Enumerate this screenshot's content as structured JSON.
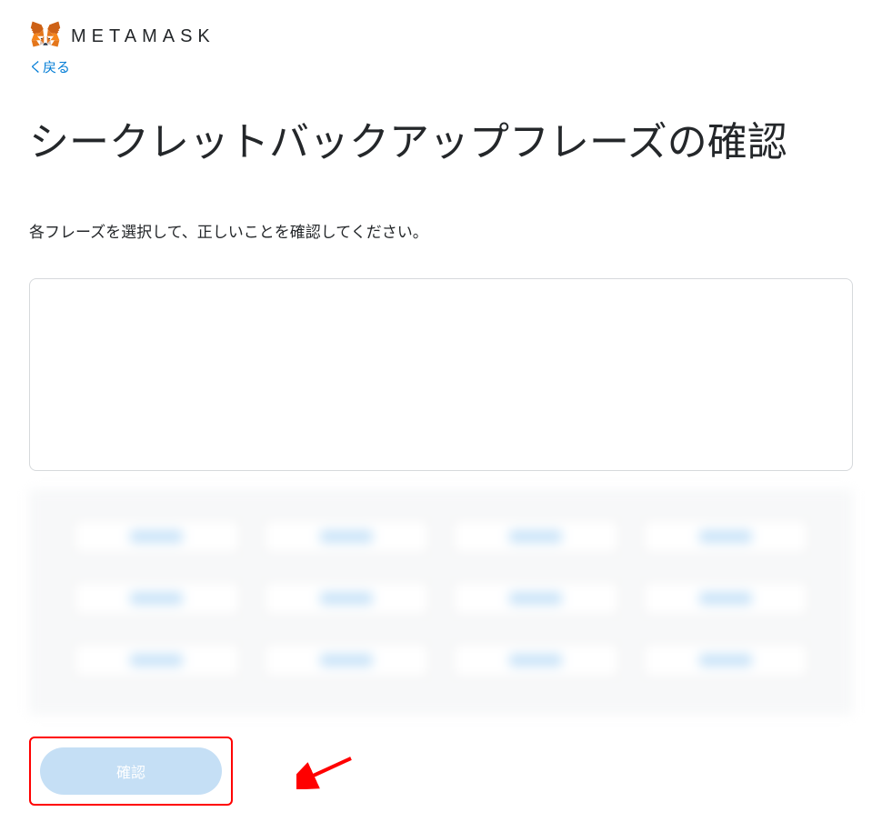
{
  "header": {
    "brand_name": "METAMASK"
  },
  "back_link": {
    "label": "く戻る"
  },
  "page_title": "シークレットバックアップフレーズの確認",
  "instruction": "各フレーズを選択して、正しいことを確認してください。",
  "confirm_button": {
    "label": "確認"
  }
}
